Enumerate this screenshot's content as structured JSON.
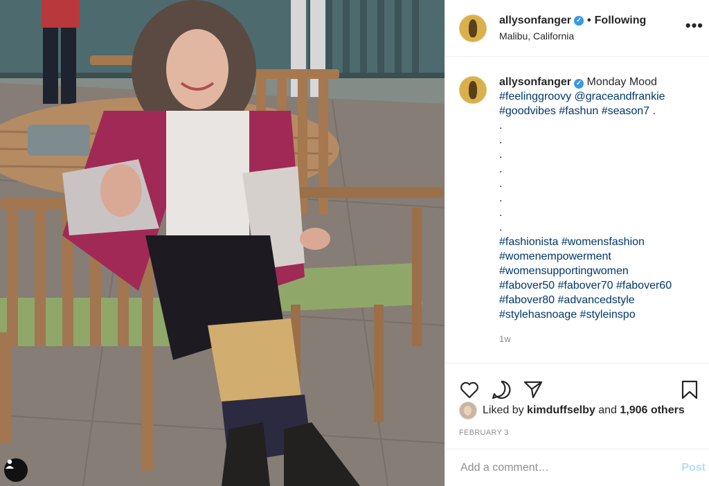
{
  "header": {
    "username": "allysonfanger",
    "separator": "•",
    "follow_status": "Following",
    "location": "Malibu, California",
    "more_icon": "more-horizontal-icon"
  },
  "caption": {
    "username": "allysonfanger",
    "lines": [
      [
        {
          "text": "Monday Mood",
          "tag": false
        }
      ],
      [
        {
          "text": "#feelinggroovy",
          "tag": true
        },
        {
          "text": " ",
          "tag": false
        },
        {
          "text": "@graceandfrankie",
          "tag": true
        }
      ],
      [
        {
          "text": "#goodvibes",
          "tag": true
        },
        {
          "text": " ",
          "tag": false
        },
        {
          "text": "#fashun",
          "tag": true
        },
        {
          "text": " ",
          "tag": false
        },
        {
          "text": "#season7",
          "tag": true
        },
        {
          "text": " .",
          "tag": false
        }
      ],
      [
        {
          "text": ".",
          "tag": false
        }
      ],
      [
        {
          "text": ".",
          "tag": false
        }
      ],
      [
        {
          "text": ".",
          "tag": false
        }
      ],
      [
        {
          "text": ".",
          "tag": false
        }
      ],
      [
        {
          "text": ".",
          "tag": false
        }
      ],
      [
        {
          "text": ".",
          "tag": false
        }
      ],
      [
        {
          "text": ".",
          "tag": false
        }
      ],
      [
        {
          "text": ".",
          "tag": false
        }
      ],
      [
        {
          "text": "#fashionista",
          "tag": true
        },
        {
          "text": " ",
          "tag": false
        },
        {
          "text": "#womensfashion",
          "tag": true
        }
      ],
      [
        {
          "text": "#womenempowerment",
          "tag": true
        }
      ],
      [
        {
          "text": "#womensupportingwomen",
          "tag": true
        }
      ],
      [
        {
          "text": "#fabover50",
          "tag": true
        },
        {
          "text": " ",
          "tag": false
        },
        {
          "text": "#fabover70",
          "tag": true
        },
        {
          "text": " ",
          "tag": false
        },
        {
          "text": "#fabover60",
          "tag": true
        }
      ],
      [
        {
          "text": "#fabover80",
          "tag": true
        },
        {
          "text": " ",
          "tag": false
        },
        {
          "text": "#advancedstyle",
          "tag": true
        }
      ],
      [
        {
          "text": "#stylehasnoage",
          "tag": true
        },
        {
          "text": " ",
          "tag": false
        },
        {
          "text": "#styleinspo",
          "tag": true
        }
      ]
    ],
    "time_ago": "1w"
  },
  "actions": {
    "icons": [
      "heart-icon",
      "comment-icon",
      "share-icon",
      "bookmark-icon"
    ]
  },
  "likes": {
    "prefix": "Liked by",
    "liker": "kimduffselby",
    "middle": "and",
    "others": "1,906 others"
  },
  "date": "FEBRUARY 3",
  "comment": {
    "placeholder": "Add a comment…",
    "post_label": "Post"
  },
  "colors": {
    "verified_blue": "#3897f0",
    "tag_blue": "#00376b",
    "post_disabled": "#b2dffc"
  }
}
